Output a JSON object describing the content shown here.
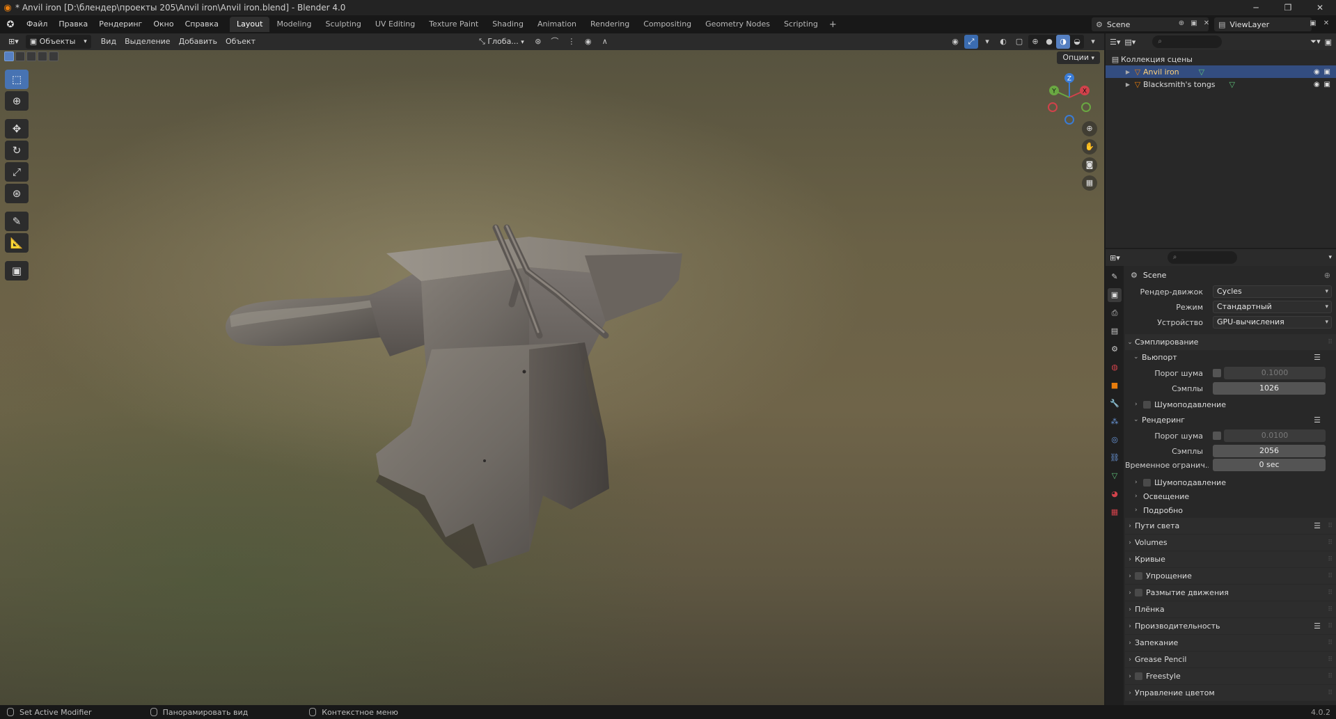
{
  "window": {
    "title": "* Anvil iron [D:\\блендер\\проекты 205\\Anvil iron\\Anvil iron.blend] - Blender 4.0",
    "minimize": "─",
    "maximize": "❐",
    "close": "✕"
  },
  "menu": [
    "Файл",
    "Правка",
    "Рендеринг",
    "Окно",
    "Справка"
  ],
  "workspaces": [
    "Layout",
    "Modeling",
    "Sculpting",
    "UV Editing",
    "Texture Paint",
    "Shading",
    "Animation",
    "Rendering",
    "Compositing",
    "Geometry Nodes",
    "Scripting"
  ],
  "active_workspace": "Layout",
  "scene_name": "Scene",
  "view_layer": "ViewLayer",
  "viewport_header": {
    "mode": "Объекты",
    "menus": [
      "Вид",
      "Выделение",
      "Добавить",
      "Объект"
    ],
    "orientation": "Глоба...",
    "options": "Опции"
  },
  "gizmo": {
    "z": "Z",
    "y": "Y",
    "x": "X"
  },
  "outliner": {
    "collection": "Коллекция сцены",
    "items": [
      {
        "name": "Anvil iron",
        "selected": true
      },
      {
        "name": "Blacksmith's tongs",
        "selected": false
      }
    ]
  },
  "properties": {
    "context": "Scene",
    "render_engine_label": "Рендер-движок",
    "render_engine": "Cycles",
    "mode_label": "Режим",
    "mode": "Стандартный",
    "device_label": "Устройство",
    "device": "GPU-вычисления",
    "sampling": "Сэмплирование",
    "viewport": {
      "title": "Вьюпорт",
      "noise_threshold_label": "Порог шума",
      "noise_threshold": "0.1000",
      "samples_label": "Сэмплы",
      "samples": "1026",
      "denoise": "Шумоподавление"
    },
    "render": {
      "title": "Рендеринг",
      "noise_threshold_label": "Порог шума",
      "noise_threshold": "0.0100",
      "samples_label": "Сэмплы",
      "samples": "2056",
      "time_limit_label": "Временное огранич...",
      "time_limit": "0 sec",
      "denoise": "Шумоподавление",
      "lights": "Освещение",
      "advanced": "Подробно"
    },
    "panels": [
      "Пути света",
      "Volumes",
      "Кривые",
      "Упрощение",
      "Размытие движения",
      "Плёнка",
      "Производительность",
      "Запекание",
      "Grease Pencil",
      "Freestyle",
      "Управление цветом"
    ]
  },
  "status": {
    "left": "Set Active Modifier",
    "middle": "Панорамировать вид",
    "right": "Контекстное меню",
    "version": "4.0.2"
  },
  "colors": {
    "accent": "#4773b3",
    "selection": "#334d80",
    "orange": "#e87d0d"
  }
}
